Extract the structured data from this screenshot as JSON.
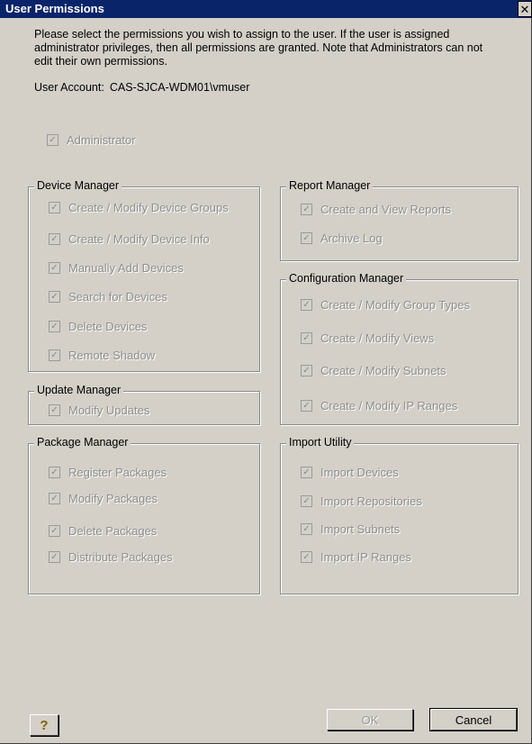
{
  "window": {
    "title": "User Permissions",
    "close_symbol": "✕"
  },
  "intro": "Please select the permissions you wish to assign to the user.  If the user is assigned administrator privileges, then all permissions are granted.  Note that Administrators can not edit their own permissions.",
  "account": {
    "label": "User Account:",
    "value": "CAS-SJCA-WDM01\\vmuser"
  },
  "administrator": {
    "label": "Administrator",
    "checked": true
  },
  "groups": {
    "device_manager": {
      "title": "Device Manager",
      "items": [
        "Create / Modify Device Groups",
        "Create / Modify Device Info",
        "Manually Add Devices",
        "Search for Devices",
        "Delete Devices",
        "Remote Shadow"
      ]
    },
    "update_manager": {
      "title": "Update Manager",
      "items": [
        "Modify Updates"
      ]
    },
    "package_manager": {
      "title": "Package Manager",
      "items": [
        "Register Packages",
        "Modify Packages",
        "Delete Packages",
        "Distribute Packages"
      ]
    },
    "report_manager": {
      "title": "Report Manager",
      "items": [
        "Create and View Reports",
        "Archive Log"
      ]
    },
    "configuration_manager": {
      "title": "Configuration Manager",
      "items": [
        "Create / Modify Group Types",
        "Create / Modify Views",
        "Create / Modify Subnets",
        "Create / Modify IP Ranges"
      ]
    },
    "import_utility": {
      "title": "Import Utility",
      "items": [
        "Import Devices",
        "Import Repositories",
        "Import Subnets",
        "Import IP Ranges"
      ]
    }
  },
  "buttons": {
    "help": "?",
    "ok": "OK",
    "cancel": "Cancel"
  },
  "check_mark": "✓"
}
